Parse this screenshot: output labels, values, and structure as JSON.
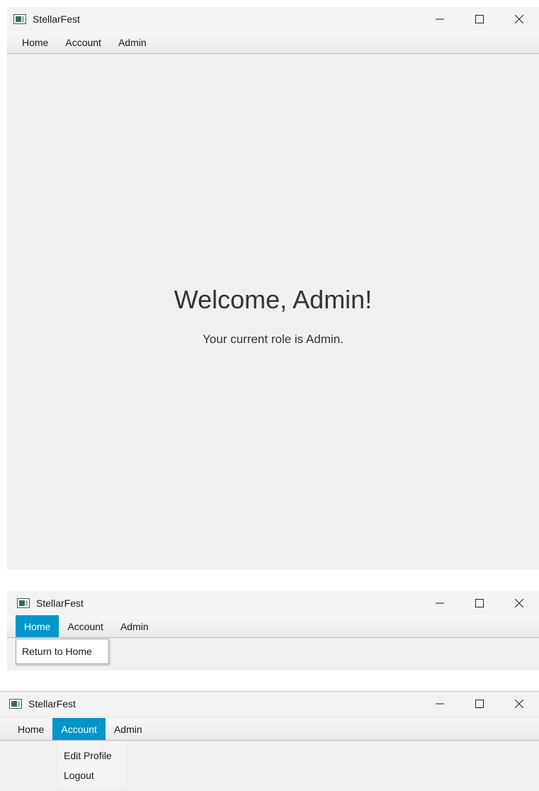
{
  "app": {
    "title": "StellarFest"
  },
  "window_controls": {
    "minimize_glyph": "—",
    "maximize_glyph": "☐",
    "close_glyph": "✕"
  },
  "menu": {
    "home": "Home",
    "account": "Account",
    "admin": "Admin"
  },
  "main": {
    "welcome": "Welcome, Admin!",
    "role_text": "Your current role is Admin."
  },
  "home_menu": {
    "items": [
      "Return to Home"
    ]
  },
  "account_menu": {
    "items": [
      "Edit Profile",
      "Logout"
    ]
  },
  "colors": {
    "menu_highlight": "#0096c9",
    "window_bg": "#f0f0f0",
    "titlebar_bg": "#f3f3f3"
  }
}
